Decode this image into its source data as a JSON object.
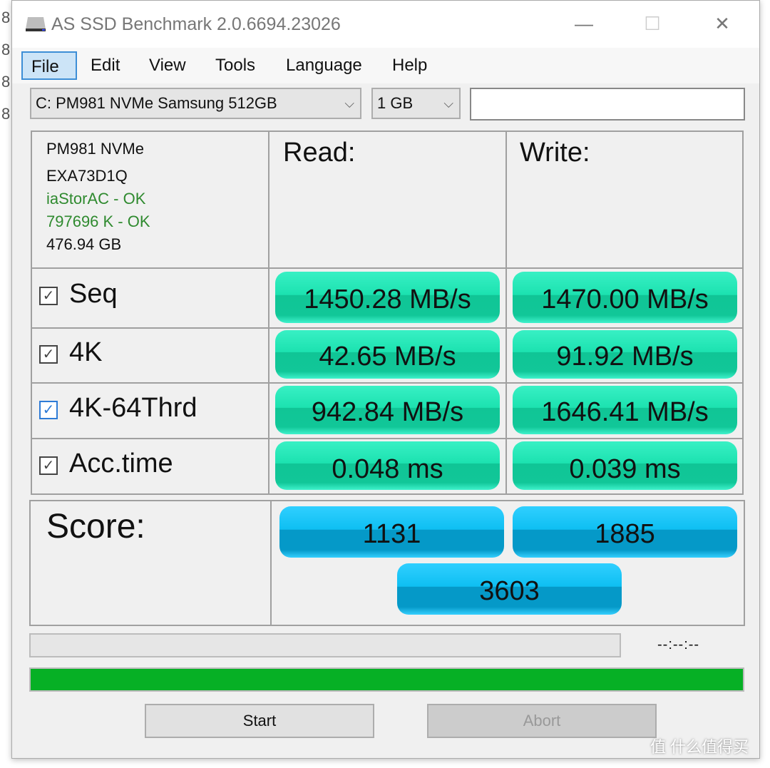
{
  "window": {
    "title": "AS SSD Benchmark 2.0.6694.23026",
    "controls": {
      "minimize": "—",
      "maximize": "☐",
      "close": "✕"
    }
  },
  "background_fragment": [
    "8",
    "8",
    "8",
    "8"
  ],
  "menu": [
    {
      "label": "File",
      "active": true
    },
    {
      "label": "Edit"
    },
    {
      "label": "View"
    },
    {
      "label": "Tools"
    },
    {
      "label": "Language"
    },
    {
      "label": "Help"
    }
  ],
  "drive_select": {
    "value": "C: PM981 NVMe Samsung 512GB"
  },
  "size_select": {
    "value": "1 GB"
  },
  "extra_field": {
    "value": ""
  },
  "drive_info": {
    "model": "PM981 NVMe",
    "firmware": "EXA73D1Q",
    "driver": "iaStorAC - OK",
    "alignment": "797696 K - OK",
    "capacity": "476.94 GB"
  },
  "columns": {
    "read": "Read:",
    "write": "Write:"
  },
  "rows": [
    {
      "label": "Seq",
      "checked": true,
      "read": "1450.28 MB/s",
      "write": "1470.00 MB/s"
    },
    {
      "label": "4K",
      "checked": true,
      "read": "42.65 MB/s",
      "write": "91.92 MB/s"
    },
    {
      "label": "4K-64Thrd",
      "checked": true,
      "focused": true,
      "read": "942.84 MB/s",
      "write": "1646.41 MB/s"
    },
    {
      "label": "Acc.time",
      "checked": true,
      "read": "0.048 ms",
      "write": "0.039 ms"
    }
  ],
  "score": {
    "label": "Score:",
    "read": "1131",
    "write": "1885",
    "total": "3603"
  },
  "status": {
    "time": "--:--:--",
    "top_progress": 0,
    "main_progress": 100
  },
  "buttons": {
    "start": "Start",
    "abort": "Abort"
  },
  "watermark": "值 什么值得买",
  "icons": {
    "check": "✓",
    "chevron": "⌵"
  }
}
